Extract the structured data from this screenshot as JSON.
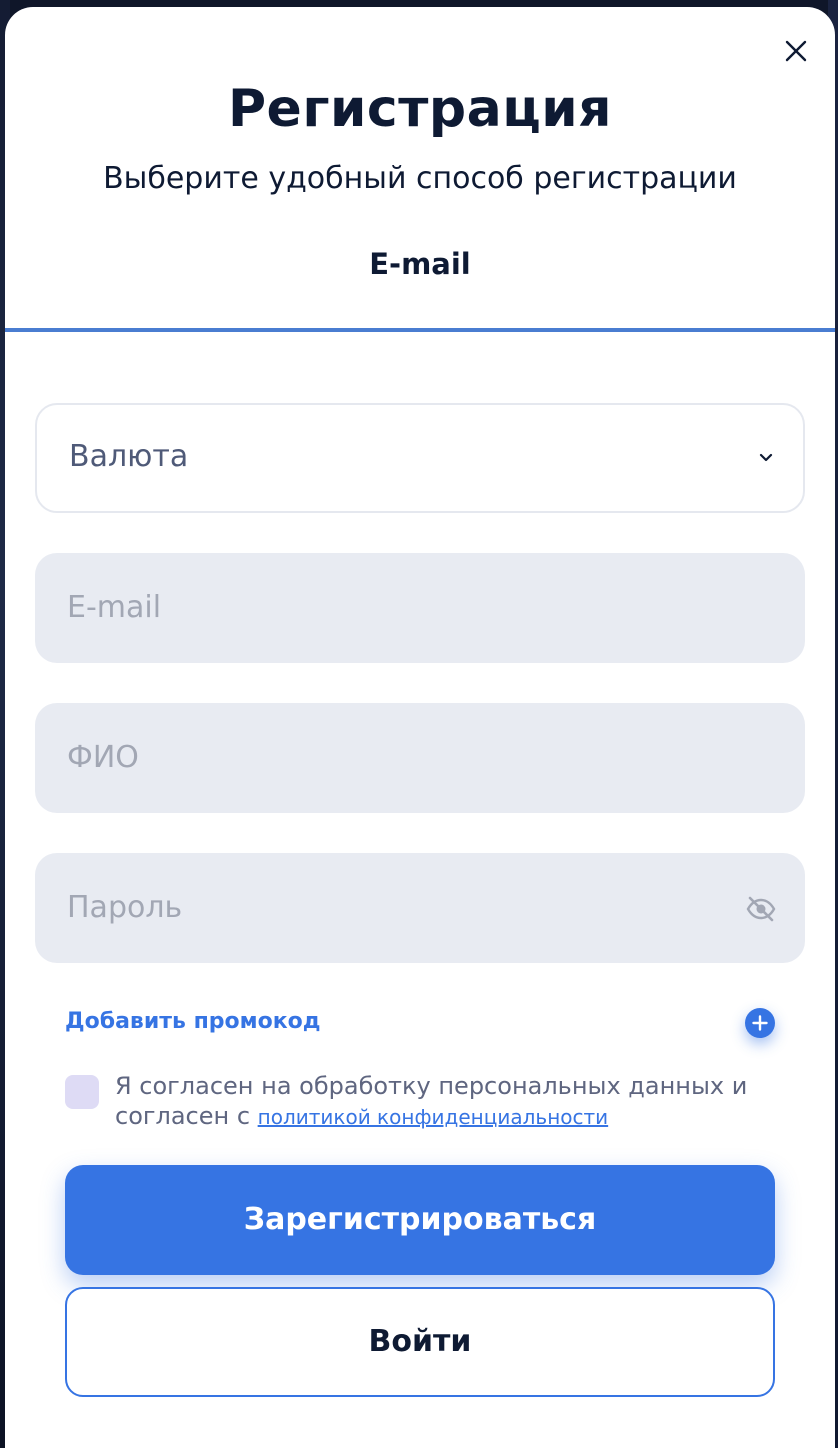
{
  "modal": {
    "title": "Регистрация",
    "subtitle": "Выберите удобный способ регистрации",
    "active_tab": "E-mail"
  },
  "form": {
    "currency_select": {
      "label": "Валюта"
    },
    "email_field": {
      "placeholder": "E-mail"
    },
    "name_field": {
      "placeholder": "ФИО"
    },
    "password_field": {
      "placeholder": "Пароль"
    },
    "promo_label": "Добавить промокод",
    "consent_text": "Я согласен на обработку персональных данных и согласен с ",
    "consent_link": "политикой конфиденциальности",
    "consent_checked": false
  },
  "actions": {
    "register_label": "Зарегистрироваться",
    "login_label": "Войти"
  },
  "colors": {
    "accent": "#3674e3",
    "title_text": "#0e1a33",
    "input_bg": "#e8ebf2",
    "checkbox_bg": "#dedbf5"
  },
  "icons": [
    "close-icon",
    "chevron-down-icon",
    "eye-off-icon",
    "plus-icon"
  ]
}
